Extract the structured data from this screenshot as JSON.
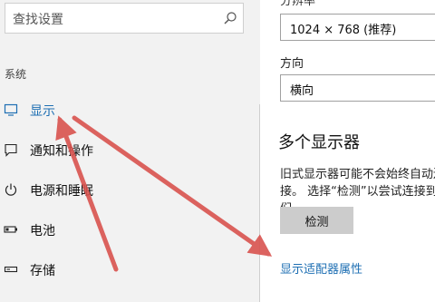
{
  "search": {
    "placeholder": "查找设置",
    "icon": "search-icon"
  },
  "sidebar": {
    "group_label": "系统",
    "items": [
      {
        "label": "显示",
        "icon": "monitor-icon",
        "active": true
      },
      {
        "label": "通知和操作",
        "icon": "notification-icon",
        "active": false
      },
      {
        "label": "电源和睡眠",
        "icon": "power-icon",
        "active": false
      },
      {
        "label": "电池",
        "icon": "battery-icon",
        "active": false
      },
      {
        "label": "存储",
        "icon": "storage-icon",
        "active": false
      }
    ]
  },
  "main": {
    "resolution_label": "分辨率",
    "resolution_value": "1024 × 768 (推荐)",
    "orientation_label": "方向",
    "orientation_value": "横向",
    "multiple_displays_title": "多个显示器",
    "multiple_displays_desc": "旧式显示器可能不会始终自动连接。 选择“检测”以尝试连接到它们。",
    "detect_button": "检测",
    "adapter_link": "显示适配器属性"
  },
  "colors": {
    "accent": "#1e6fb3",
    "arrow": "#d9534f"
  }
}
